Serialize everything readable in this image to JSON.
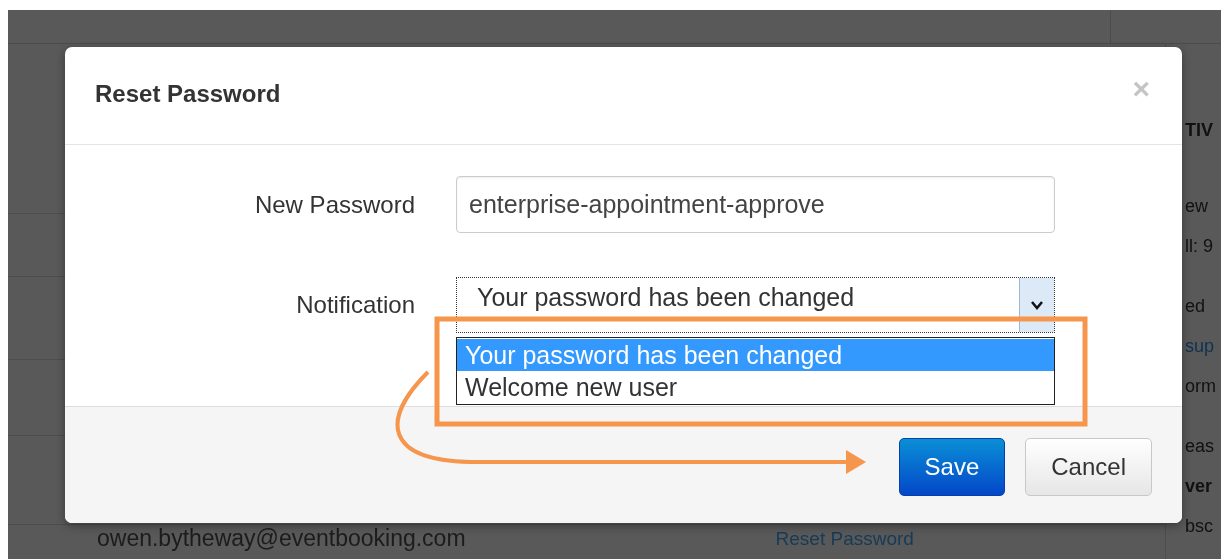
{
  "background": {
    "side_panel": [
      [
        {
          "text": "TIV",
          "kind": "heading"
        }
      ],
      [
        {
          "text": "ew",
          "kind": "text"
        },
        {
          "text": "ll: 9",
          "kind": "text"
        }
      ],
      [
        {
          "text": "ed",
          "kind": "text"
        },
        {
          "text": "sup",
          "kind": "link"
        },
        {
          "text": "orm",
          "kind": "text"
        }
      ],
      [
        {
          "text": "eas",
          "kind": "text"
        },
        {
          "text": "ver",
          "kind": "heading"
        },
        {
          "text": "bsc",
          "kind": "text"
        }
      ]
    ],
    "row": {
      "email": "owen.bytheway@eventbooking.com",
      "action": "Reset Password"
    }
  },
  "dialog": {
    "title": "Reset Password",
    "close": "×",
    "new_password": {
      "label": "New Password",
      "value": "enterprise-appointment-approve"
    },
    "notification": {
      "label": "Notification",
      "value": "Your password has been changed",
      "expanded": true,
      "options": [
        {
          "label": "Your password has been changed",
          "selected": true
        },
        {
          "label": "Welcome new user",
          "selected": false
        }
      ]
    },
    "buttons": [
      {
        "label": "Save",
        "kind": "primary"
      },
      {
        "label": "Cancel",
        "kind": "default"
      }
    ]
  }
}
